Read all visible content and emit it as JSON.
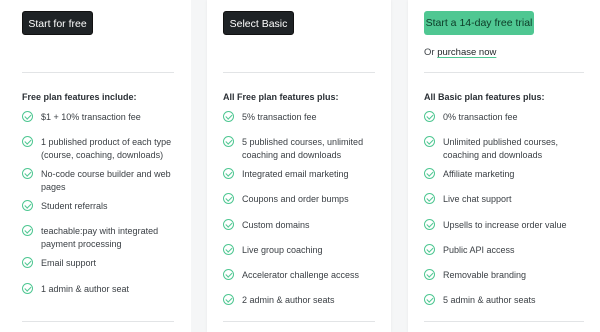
{
  "colors": {
    "accent_green": "#4fc792",
    "dark_button": "#1f2326",
    "page_bg": "#f5f6f7"
  },
  "plans": {
    "free": {
      "cta_label": "Start for free",
      "heading": "Free plan features include:",
      "features": [
        "$1 + 10% transaction fee",
        "1 published product of each type (course, coaching, downloads)",
        "No-code course builder and web pages",
        "Student referrals",
        "teachable:pay with integrated payment processing",
        "Email support",
        "1 admin & author seat"
      ]
    },
    "basic": {
      "cta_label": "Select Basic",
      "heading": "All Free plan features plus:",
      "features": [
        "5% transaction fee",
        "5 published courses, unlimited coaching and downloads",
        "Integrated email marketing",
        "Coupons and order bumps",
        "Custom domains",
        "Live group coaching",
        "Accelerator challenge access",
        "2 admin & author seats"
      ]
    },
    "pro": {
      "cta_label": "Start a 14-day free trial",
      "or_text": "Or",
      "purchase_link": "purchase now",
      "heading": "All Basic plan features plus:",
      "features": [
        "0% transaction fee",
        "Unlimited published courses, coaching and downloads",
        "Affiliate marketing",
        "Live chat support",
        "Upsells to increase order value",
        "Public API access",
        "Removable branding",
        "5 admin & author seats"
      ]
    }
  }
}
